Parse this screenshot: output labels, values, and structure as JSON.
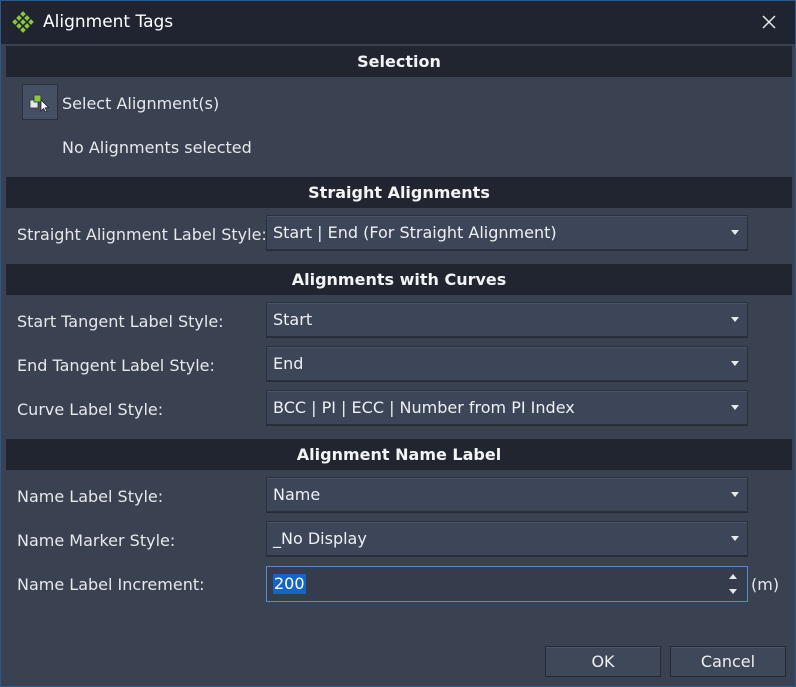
{
  "window": {
    "title": "Alignment Tags"
  },
  "selection": {
    "header": "Selection",
    "pick_label": "Select Alignment(s)",
    "status": "No Alignments selected"
  },
  "straight": {
    "header": "Straight Alignments",
    "label": "Straight Alignment Label Style:",
    "value": "Start | End (For Straight Alignment)"
  },
  "curves": {
    "header": "Alignments with Curves",
    "start_label": "Start Tangent Label Style:",
    "start_value": "Start",
    "end_label": "End Tangent Label Style:",
    "end_value": "End",
    "curve_label": "Curve Label Style:",
    "curve_value": "BCC | PI | ECC | Number from PI Index"
  },
  "name_label": {
    "header": "Alignment Name Label",
    "style_label": "Name Label Style:",
    "style_value": "Name",
    "marker_label": "Name Marker Style:",
    "marker_value": "_No Display",
    "increment_label": "Name Label Increment:",
    "increment_value": "200",
    "increment_unit": "(m)"
  },
  "buttons": {
    "ok": "OK",
    "cancel": "Cancel"
  },
  "colors": {
    "background": "#3a4252",
    "header_bar": "#20252f",
    "title_bar": "#1f2430",
    "selection_highlight": "#1565c8",
    "icon_green": "#8cc63f"
  }
}
